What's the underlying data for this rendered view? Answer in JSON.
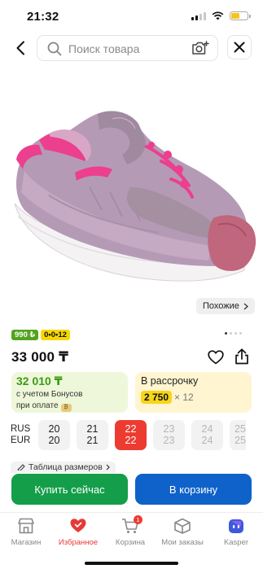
{
  "status_bar": {
    "time": "21:32"
  },
  "search": {
    "placeholder": "Поиск товара"
  },
  "product": {
    "price": "33 000 ₸"
  },
  "similar": {
    "label": "Похожие"
  },
  "badges": {
    "bonus": "990 ₺",
    "installment": "0•0•12"
  },
  "bonus_card": {
    "price": "32 010 ₸",
    "line1": "с учетом Бонусов",
    "line2": "при оплате"
  },
  "installment_card": {
    "title": "В рассрочку",
    "amount": "2 750",
    "multiplier": "× 12"
  },
  "sizes": {
    "label_ru": "RUS",
    "label_eu": "EUR",
    "items": [
      {
        "rus": "20",
        "eur": "20",
        "state": "available"
      },
      {
        "rus": "21",
        "eur": "21",
        "state": "available"
      },
      {
        "rus": "22",
        "eur": "22",
        "state": "selected"
      },
      {
        "rus": "23",
        "eur": "23",
        "state": "unavailable"
      },
      {
        "rus": "24",
        "eur": "24",
        "state": "unavailable"
      },
      {
        "rus": "25",
        "eur": "25",
        "state": "unavailable"
      }
    ]
  },
  "size_table": {
    "label": "Таблица размеров"
  },
  "actions": {
    "buy_now": "Купить сейчас",
    "add_to_cart": "В корзину"
  },
  "tabbar": {
    "items": [
      {
        "label": "Магазин",
        "icon": "store-icon"
      },
      {
        "label": "Избранное",
        "icon": "heart-icon"
      },
      {
        "label": "Корзина",
        "icon": "cart-icon",
        "badge": "1"
      },
      {
        "label": "Мои заказы",
        "icon": "orders-icon"
      },
      {
        "label": "Kasper",
        "icon": "kasper-icon"
      }
    ]
  },
  "colors": {
    "accent_red": "#ee3b32",
    "buy_green": "#149e4a",
    "cart_blue": "#0f62c9",
    "bonus_green": "#3a9a14"
  }
}
